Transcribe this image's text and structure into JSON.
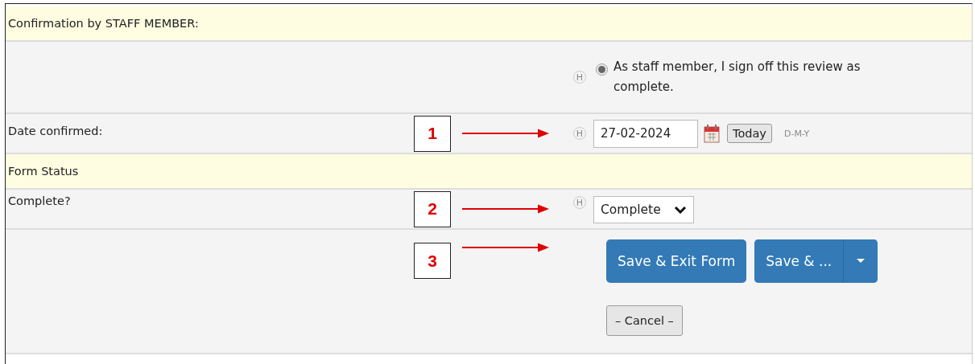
{
  "rows": [
    {
      "kind": "header",
      "label": "Confirmation by STAFF MEMBER:"
    },
    {
      "kind": "radio",
      "help": "H",
      "option": "As staff member, I sign off this review as complete.",
      "selected": true
    },
    {
      "kind": "date",
      "label": "Date confirmed:",
      "callout": "1",
      "help": "H",
      "value": "27-02-2024",
      "today": "Today",
      "format": "D-M-Y"
    },
    {
      "kind": "header",
      "label": "Form Status"
    },
    {
      "kind": "select",
      "label": "Complete?",
      "callout": "2",
      "help": "H",
      "value": "Complete"
    },
    {
      "kind": "buttons",
      "callout": "3",
      "save_exit": "Save & Exit Form",
      "save_more": "Save & ...",
      "cancel": "– Cancel –"
    }
  ]
}
